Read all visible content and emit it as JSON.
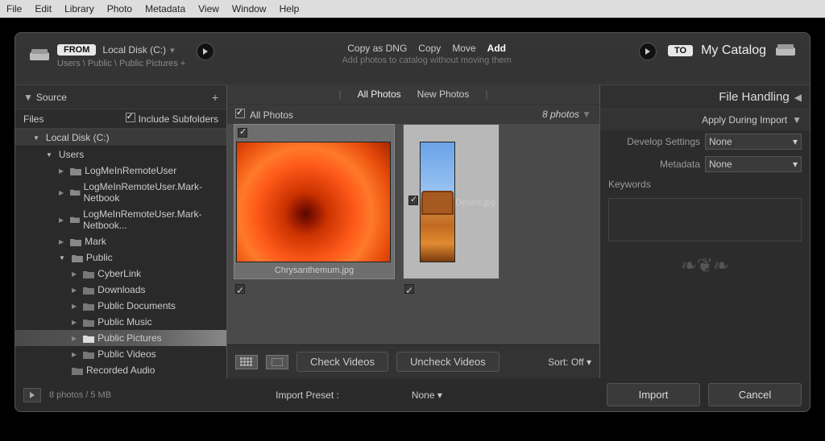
{
  "menu": [
    "File",
    "Edit",
    "Library",
    "Photo",
    "Metadata",
    "View",
    "Window",
    "Help"
  ],
  "from": {
    "badge": "FROM",
    "title": "Local Disk (C:)",
    "path": "Users \\ Public \\ Public Pictures +"
  },
  "ops": {
    "copy_dng": "Copy as DNG",
    "copy": "Copy",
    "move": "Move",
    "add": "Add",
    "sub": "Add photos to catalog without moving them"
  },
  "to": {
    "badge": "TO",
    "title": "My Catalog"
  },
  "source": {
    "title": "Source",
    "files": "Files",
    "include_sub": "Include Subfolders"
  },
  "tree": {
    "disk": "Local Disk (C:)",
    "users": "Users",
    "items": [
      "LogMeInRemoteUser",
      "LogMeInRemoteUser.Mark-Netbook",
      "LogMeInRemoteUser.Mark-Netbook...",
      "Mark",
      "Public"
    ],
    "public": [
      "CyberLink",
      "Downloads",
      "Public Documents",
      "Public Music",
      "Public Pictures",
      "Public Videos",
      "Recorded Audio"
    ]
  },
  "mid": {
    "tabs": {
      "all": "All Photos",
      "new": "New Photos"
    },
    "title": "All Photos",
    "count": "8 photos",
    "thumbs": [
      {
        "name": "Chrysanthemum.jpg"
      },
      {
        "name": "Desert.jpg"
      }
    ],
    "check_videos": "Check Videos",
    "uncheck_videos": "Uncheck Videos",
    "sort": "Sort:",
    "sort_val": "Off"
  },
  "right": {
    "file_handling": "File Handling",
    "apply": "Apply During Import",
    "develop": "Develop Settings",
    "metadata": "Metadata",
    "none": "None",
    "keywords": "Keywords"
  },
  "footer": {
    "status": "8 photos / 5 MB",
    "preset_label": "Import Preset :",
    "preset_val": "None",
    "import": "Import",
    "cancel": "Cancel"
  }
}
